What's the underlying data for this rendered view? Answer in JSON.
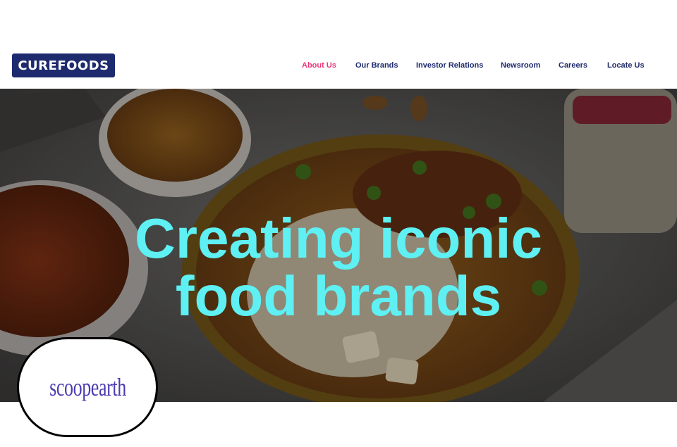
{
  "header": {
    "logo_text": "CUREFOODS",
    "nav": [
      {
        "label": "About Us",
        "active": true
      },
      {
        "label": "Our Brands"
      },
      {
        "label": "Investor Relations"
      },
      {
        "label": "Newsroom"
      },
      {
        "label": "Careers"
      },
      {
        "label": "Locate Us"
      }
    ]
  },
  "hero": {
    "title_line1": "Creating iconic",
    "title_line2": "food brands"
  },
  "watermark": {
    "text": "scoopearth"
  },
  "colors": {
    "brand_navy": "#1d2a6e",
    "nav_active": "#e8397a",
    "hero_title": "#5ef0f2",
    "watermark_text": "#4b3bb0"
  }
}
